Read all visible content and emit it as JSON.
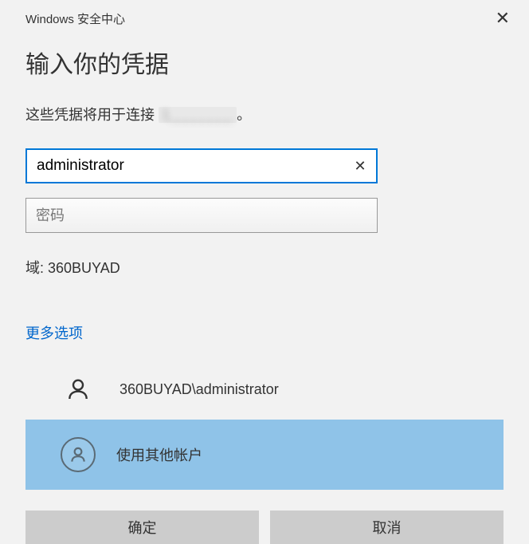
{
  "titlebar": {
    "title": "Windows 安全中心"
  },
  "heading": "输入你的凭据",
  "description_prefix": "这些凭据将用于连接 ",
  "description_blurred": "1________",
  "description_suffix": "。",
  "username": {
    "value": "administrator"
  },
  "password": {
    "placeholder": "密码",
    "value": ""
  },
  "domain_label": "域: 360BUYAD",
  "more_options": "更多选项",
  "accounts": {
    "existing_label": "360BUYAD\\administrator",
    "other_label": "使用其他帐户"
  },
  "buttons": {
    "ok": "确定",
    "cancel": "取消"
  }
}
